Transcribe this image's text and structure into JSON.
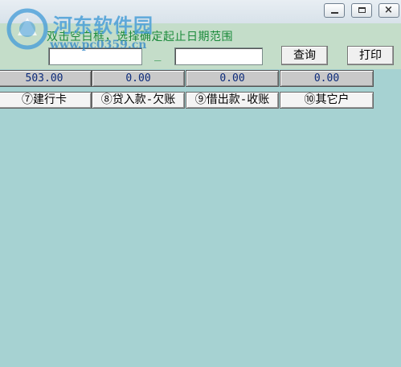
{
  "window": {
    "minimize_glyph": "",
    "close_glyph": "×"
  },
  "filter": {
    "instruction": "双击空白框，选择确定起止日期范围",
    "date_start_value": "",
    "date_end_value": "",
    "separator": "_",
    "query_label": "查询",
    "print_label": "打印"
  },
  "amounts": [
    "503.00",
    "0.00",
    "0.00",
    "0.00"
  ],
  "tabs": [
    "⑦建行卡",
    "⑧贷入款-欠账",
    "⑨借出款-收账",
    "⑩其它户"
  ],
  "watermark": {
    "name": "河东软件园",
    "url": "www.pc0359.cn"
  }
}
